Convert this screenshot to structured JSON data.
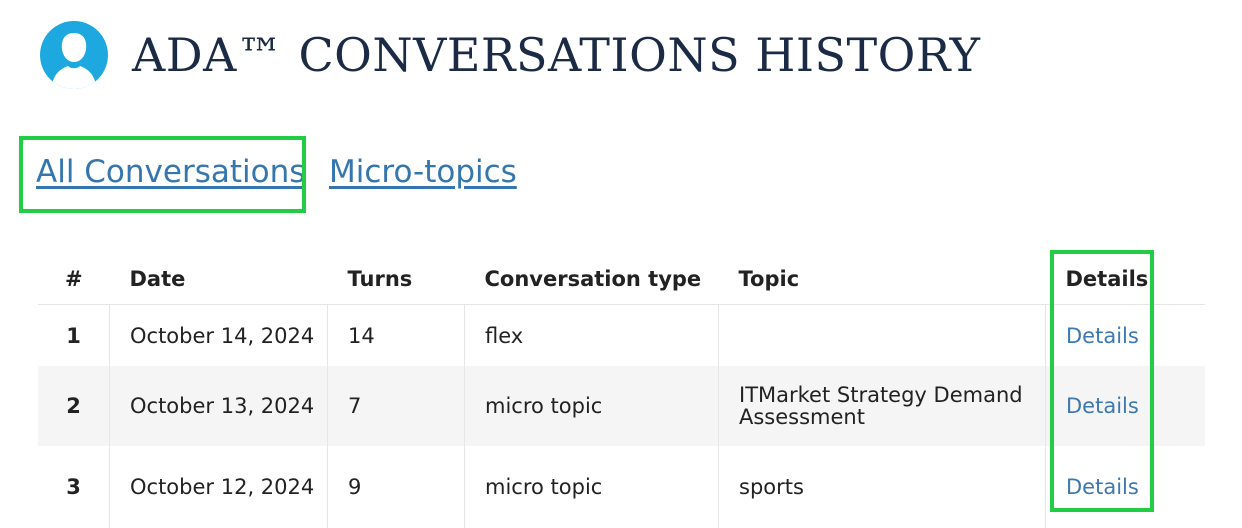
{
  "page": {
    "title": "ADA™ CONVERSATIONS HISTORY"
  },
  "tabs": [
    {
      "label": "All Conversations"
    },
    {
      "label": "Micro-topics"
    }
  ],
  "table": {
    "headers": [
      "#",
      "Date",
      "Turns",
      "Conversation type",
      "Topic",
      "Details"
    ],
    "rows": [
      {
        "num": "1",
        "date": "October 14, 2024",
        "turns": "14",
        "type": "flex",
        "topic": "",
        "details": "Details"
      },
      {
        "num": "2",
        "date": "October 13, 2024",
        "turns": "7",
        "type": "micro topic",
        "topic": "ITMarket Strategy Demand Assessment",
        "details": "Details"
      },
      {
        "num": "3",
        "date": "October 12, 2024",
        "turns": "9",
        "type": "micro topic",
        "topic": "sports",
        "details": "Details"
      }
    ]
  },
  "colors": {
    "avatar": "#1ea8e0",
    "link": "#3476ad",
    "highlight": "#22cc44",
    "title": "#1c2b45"
  },
  "icons": {
    "avatar": "user-avatar-icon"
  }
}
